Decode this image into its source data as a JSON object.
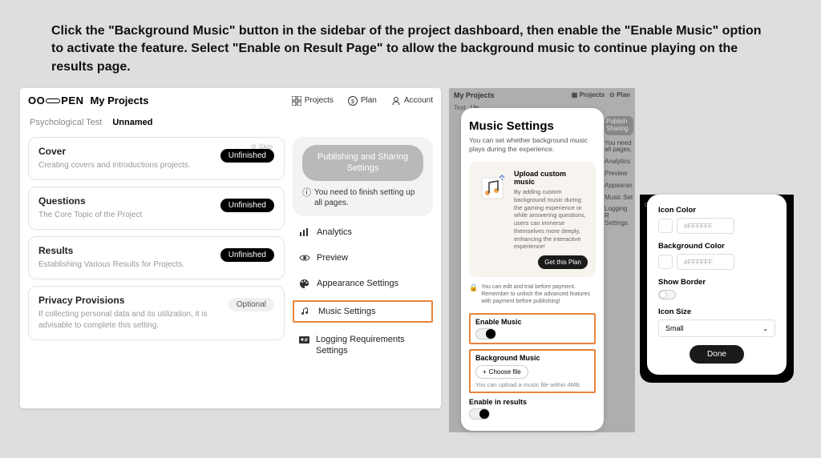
{
  "instructions": "Click the \"Background Music\" button in the sidebar of the project dashboard, then enable the \"Enable Music\" option to activate the feature. Select \"Enable on Result Page\" to allow the background music to continue playing on the results page.",
  "panel_a": {
    "logo": "OOOPEN",
    "title": "My Projects",
    "nav": {
      "projects": "Projects",
      "plan": "Plan",
      "account": "Account"
    },
    "breadcrumb": {
      "category": "Psychological Test",
      "name": "Unnamed"
    },
    "cards": [
      {
        "title": "Cover",
        "desc": "Creating covers and introductions projects.",
        "badge": "Unfinished",
        "skip": "Skip"
      },
      {
        "title": "Questions",
        "desc": "The Core Topic of the Project",
        "badge": "Unfinished"
      },
      {
        "title": "Results",
        "desc": "Establishing Various Results for Projects.",
        "badge": "Unfinished"
      },
      {
        "title": "Privacy Provisions",
        "desc": "If collecting personal data and its utilization, it is advisable to complete this setting.",
        "badge": "Optional"
      }
    ],
    "publish": {
      "button": "Publishing and Sharing Settings",
      "note": "You need to finish setting up all pages."
    },
    "side": [
      {
        "label": "Analytics"
      },
      {
        "label": "Preview"
      },
      {
        "label": "Appearance Settings"
      },
      {
        "label": "Music Settings"
      },
      {
        "label": "Logging Requirements Settings"
      }
    ]
  },
  "panel_b_bg": {
    "title": "My Projects",
    "nav": {
      "projects": "Projects",
      "plan": "Plan"
    },
    "left_crumb": "Test",
    "left_crumb2": "Un",
    "right": [
      "Publish Sharing",
      "You need all pages.",
      "Analytics",
      "Preview",
      "Appearan",
      "Music Set",
      "Logging R Settings"
    ]
  },
  "panel_b": {
    "title": "Music Settings",
    "subtitle": "You can set whether background music plays during the experience.",
    "upload": {
      "title": "Upload custom music",
      "desc": "By adding custom background music during the gaming experience or while answering questions, users can immerse themselves more deeply, enhancing the interactive experience!",
      "button": "Get this Plan"
    },
    "warn": "You can edit and trial before payment. Remember to unlock the advanced features with payment before publishing!",
    "enable_music": "Enable Music",
    "background_music": "Background Music",
    "choose_file": "Choose file",
    "file_note": "You can upload a music file within 4MB.",
    "enable_results": "Enable in results"
  },
  "panel_c": {
    "icon_color": {
      "label": "Icon Color",
      "value": "#FFFFFF"
    },
    "bg_color": {
      "label": "Background Color",
      "value": "#FFFFFF"
    },
    "show_border": "Show Border",
    "icon_size": {
      "label": "Icon Size",
      "value": "Small"
    },
    "done": "Done"
  }
}
